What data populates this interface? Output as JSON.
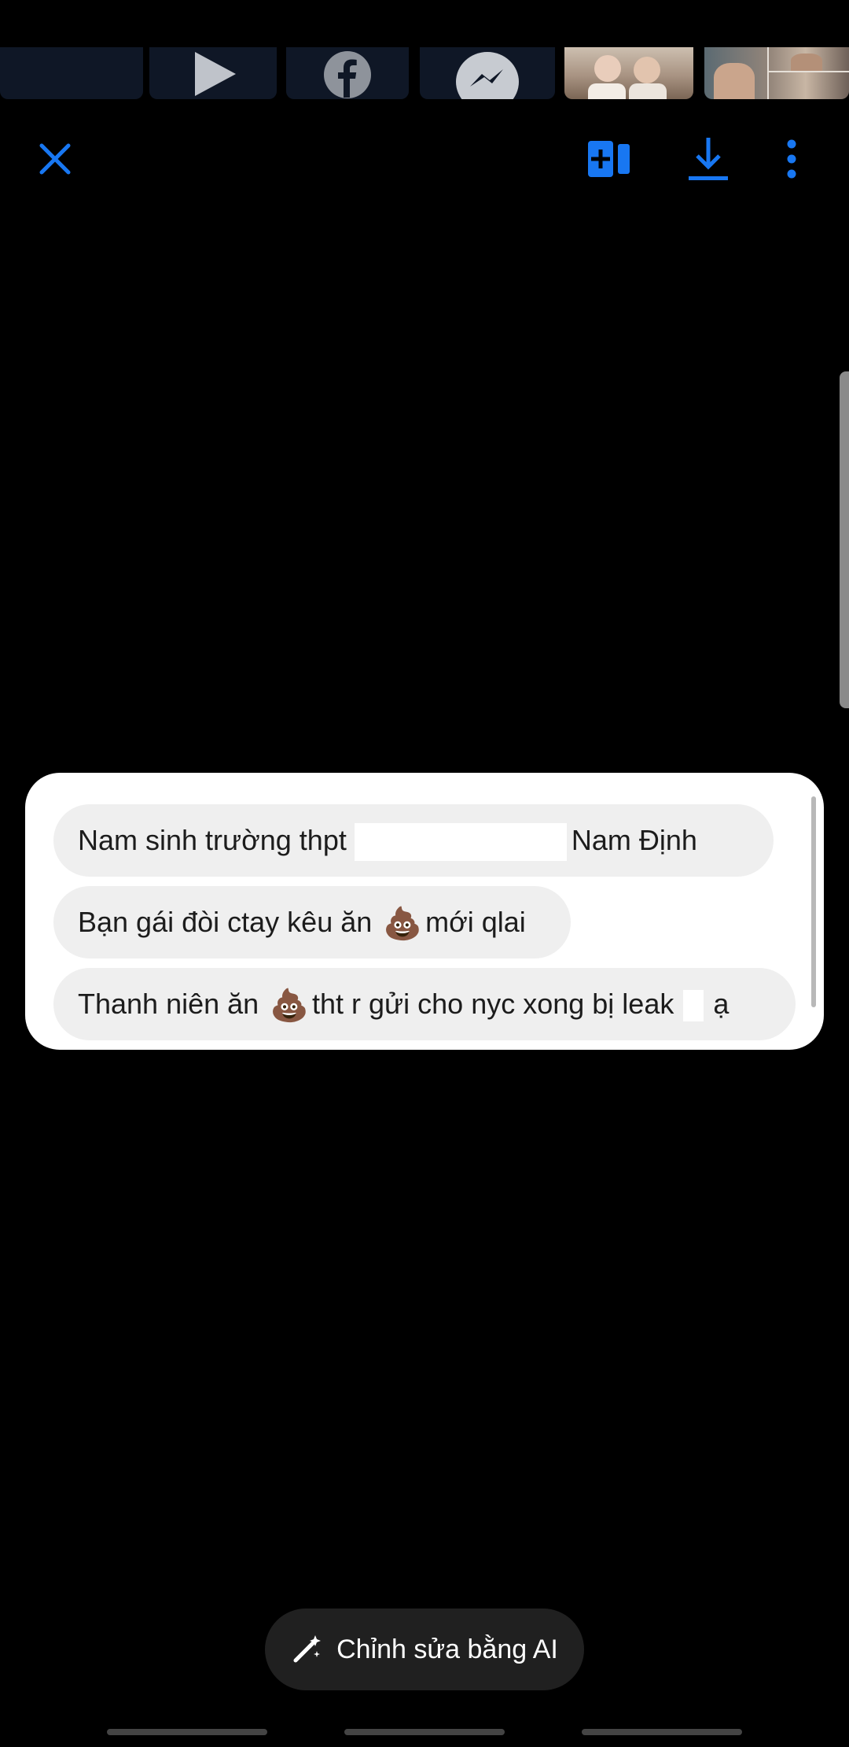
{
  "top_strip": {
    "tiles": [
      {
        "name": "video-play-icon"
      },
      {
        "name": "facebook-icon"
      },
      {
        "name": "messenger-icon"
      },
      {
        "name": "photo-thumbnail-kids"
      },
      {
        "name": "photo-thumbnail-collage"
      }
    ]
  },
  "toolbar": {
    "close_icon": "close-icon",
    "add_icon": "add-to-collection-icon",
    "download_icon": "download-icon",
    "more_icon": "more-vertical-icon",
    "accent_color": "#1877F2"
  },
  "messages": {
    "line1_a": "Nam sinh trường thpt",
    "line1_b": "Nam Định",
    "line2_a": "Bạn gái đòi ctay kêu ăn",
    "line2_b": "mới qlai",
    "line3_a": "Thanh niên ăn",
    "line3_b": "tht r gửi cho nyc xong bị leak",
    "line3_c": "ạ",
    "emoji": "💩"
  },
  "ai_button": {
    "label": "Chỉnh sửa bằng AI",
    "icon": "magic-pen-icon"
  }
}
